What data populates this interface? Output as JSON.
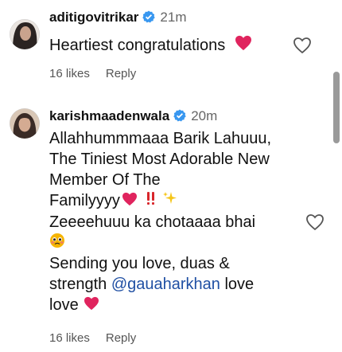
{
  "comments": [
    {
      "username": "aditigovitrikar",
      "time": "21m",
      "lines": [
        "Heartiest congratulations"
      ],
      "likes": "16 likes",
      "reply": "Reply"
    },
    {
      "username": "karishmaadenwala",
      "time": "20m",
      "lines": [
        "Allahhummmaaa Barik Lahuuu,",
        "The Tiniest Most Adorable New",
        "Member Of The",
        "Familyyyy",
        "Zeeeehuuu ka chotaaaa bhai",
        "Sending you love, duas &",
        "strength",
        "@gauaharkhan",
        "love",
        "love"
      ],
      "likes": "16 likes",
      "reply": "Reply"
    }
  ],
  "colors": {
    "heart": "#e0245e",
    "verified": "#3897f0",
    "muted": "#555555"
  },
  "icons": [
    "verified-badge-icon",
    "like-heart-icon",
    "red-heart-emoji",
    "double-exclamation-emoji",
    "sparkles-emoji",
    "pleading-face-emoji"
  ]
}
